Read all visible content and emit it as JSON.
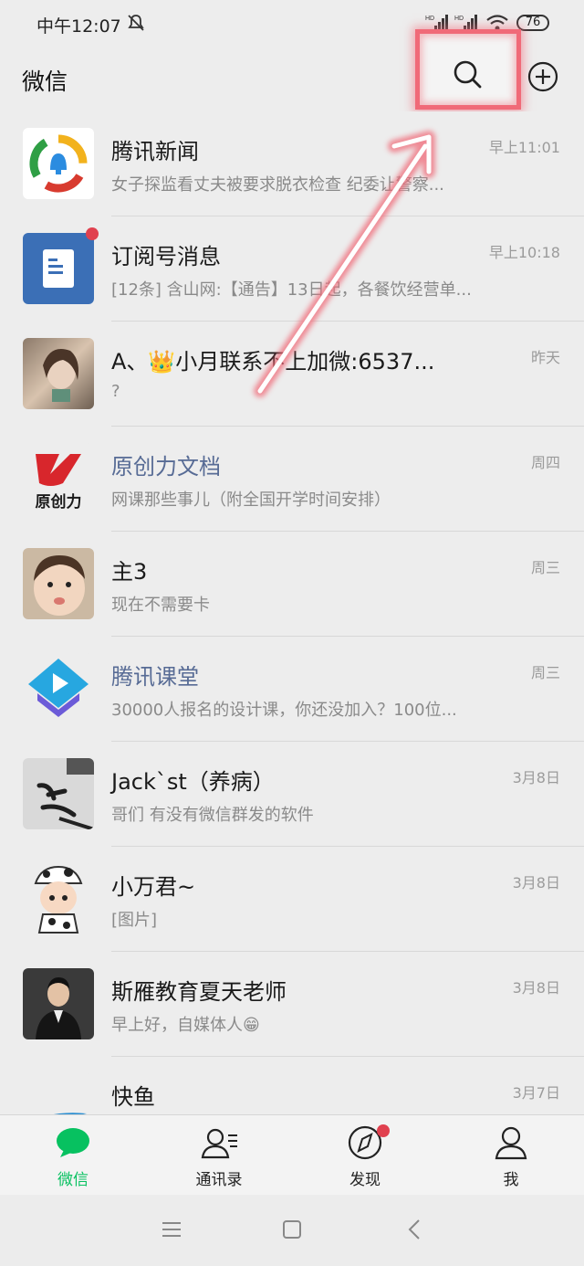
{
  "status_bar": {
    "time": "中午12:07",
    "battery": "76",
    "signal_labels": [
      "HD",
      "HD"
    ]
  },
  "app_bar": {
    "title": "微信"
  },
  "chats": [
    {
      "name": "腾讯新闻",
      "message": "女子探监看丈夫被要求脱衣检查 纪委让警察...",
      "time": "早上11:01",
      "name_color": "#1a1a1a"
    },
    {
      "name": "订阅号消息",
      "message": "[12条] 含山网:【通告】13日起，各餐饮经营单...",
      "time": "早上10:18",
      "name_color": "#1a1a1a",
      "badge": true
    },
    {
      "name": "A、👑小月联系不上加微:6537...",
      "message": "?",
      "time": "昨天",
      "name_color": "#1a1a1a"
    },
    {
      "name": "原创力文档",
      "message": "网课那些事儿（附全国开学时间安排）",
      "time": "周四",
      "name_color": "#576b95"
    },
    {
      "name": "主3",
      "message": "现在不需要卡",
      "time": "周三",
      "name_color": "#1a1a1a"
    },
    {
      "name": "腾讯课堂",
      "message": "30000人报名的设计课，你还没加入？100位...",
      "time": "周三",
      "name_color": "#576b95"
    },
    {
      "name": "Jack`st（养病）",
      "message": "哥们 有没有微信群发的软件",
      "time": "3月8日",
      "name_color": "#1a1a1a"
    },
    {
      "name": "小万君~",
      "message": "[图片]",
      "time": "3月8日",
      "name_color": "#1a1a1a"
    },
    {
      "name": "斯雁教育夏天老师",
      "message": "早上好，自媒体人😁",
      "time": "3月8日",
      "name_color": "#1a1a1a"
    },
    {
      "name": "快鱼",
      "message": "",
      "time": "3月7日",
      "name_color": "#1a1a1a"
    }
  ],
  "avatars": [
    "tencent-news-logo",
    "subscription-icon",
    "profile-photo",
    "yuanchuangli-logo",
    "baby-photo",
    "tencent-classroom-logo",
    "calligraphy-photo",
    "cartoon-avatar",
    "teacher-photo",
    "kuaiyu-logo"
  ],
  "avatar_text": {
    "yuanchuangli": "原创力"
  },
  "tabs": [
    {
      "label": "微信",
      "icon": "chat-icon",
      "active": true
    },
    {
      "label": "通讯录",
      "icon": "contacts-icon",
      "active": false
    },
    {
      "label": "发现",
      "icon": "discover-icon",
      "active": false,
      "badge": true
    },
    {
      "label": "我",
      "icon": "me-icon",
      "active": false
    }
  ],
  "colors": {
    "accent": "#07c160",
    "highlight": "#f06a78",
    "badge": "#e0414f",
    "link_name": "#576b95"
  }
}
